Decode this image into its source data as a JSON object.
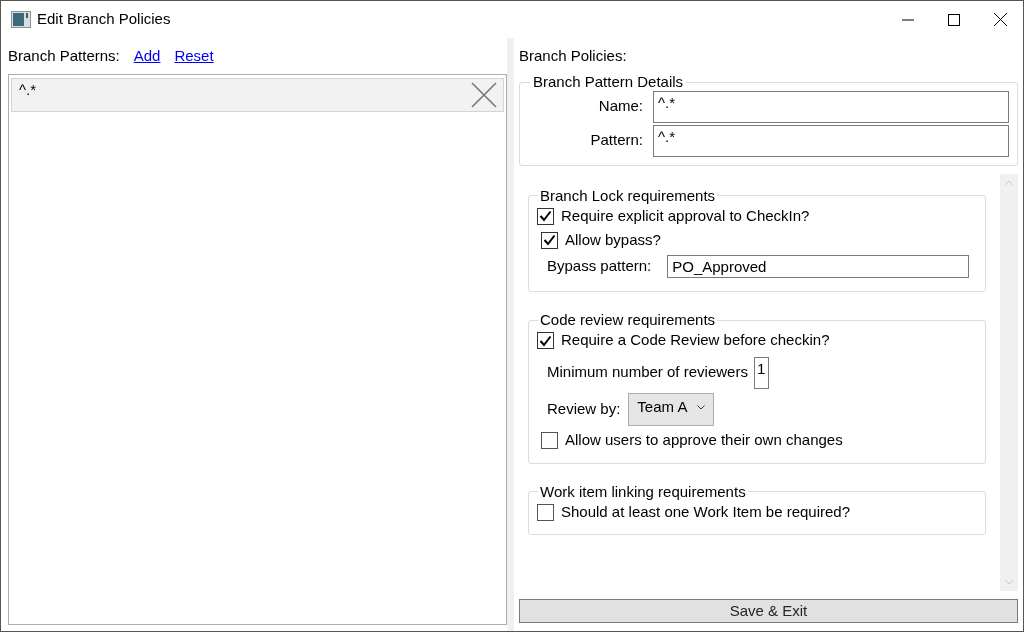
{
  "window": {
    "title": "Edit Branch Policies"
  },
  "branch_patterns": {
    "label": "Branch Patterns:",
    "links": [
      "Add",
      "Reset"
    ],
    "items": [
      {
        "text": "^.*"
      }
    ]
  },
  "policies": {
    "label": "Branch Policies:",
    "details": {
      "title": "Branch Pattern Details",
      "fields": [
        {
          "label": "Name:",
          "value": "^.*"
        },
        {
          "label": "Pattern:",
          "value": "^.*"
        }
      ]
    },
    "sections": [
      {
        "title": "Branch Lock requirements",
        "rows": [
          {
            "kind": "main_checkbox",
            "label": "Require explicit approval to CheckIn?",
            "checked": true
          },
          {
            "kind": "checkbox",
            "label": "Allow bypass?",
            "checked": true
          },
          {
            "kind": "text_field",
            "label": "Bypass pattern:",
            "value": "PO_Approved"
          }
        ]
      },
      {
        "title": "Code review requirements",
        "rows": [
          {
            "kind": "main_checkbox",
            "label": "Require a Code Review before checkin?",
            "checked": true
          },
          {
            "kind": "number_field",
            "label": "Minimum number of reviewers",
            "value": "1"
          },
          {
            "kind": "dropdown",
            "label": "Review by:",
            "value": "Team A"
          },
          {
            "kind": "checkbox",
            "label": "Allow users to approve their own changes",
            "checked": false
          }
        ]
      },
      {
        "title": "Work item linking requirements",
        "rows": [
          {
            "kind": "main_checkbox",
            "label": "Should at least one Work Item be required?",
            "checked": false
          }
        ]
      }
    ]
  },
  "save_button": "Save & Exit"
}
